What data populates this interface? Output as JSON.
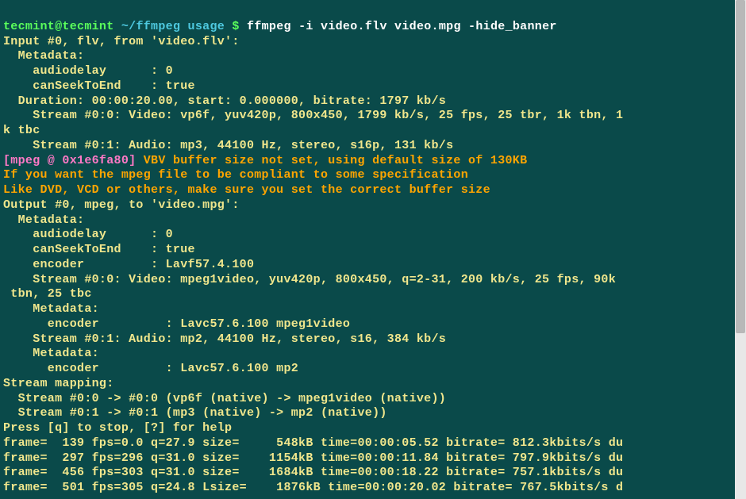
{
  "prompt": {
    "user": "tecmint@tecmint",
    "path": "~/ffmpeg usage",
    "symbol": "$",
    "command": "ffmpeg -i video.flv video.mpg -hide_banner"
  },
  "input_header": "Input #0, flv, from 'video.flv':",
  "metadata_label": "  Metadata:",
  "input_meta": {
    "audiodelay": "    audiodelay      : 0",
    "canSeekToEnd": "    canSeekToEnd    : true"
  },
  "duration": "  Duration: 00:00:20.00, start: 0.000000, bitrate: 1797 kb/s",
  "stream_v_in": "    Stream #0:0: Video: vp6f, yuv420p, 800x450, 1799 kb/s, 25 fps, 25 tbr, 1k tbn, 1",
  "stream_v_in_cont": "k tbc",
  "stream_a_in": "    Stream #0:1: Audio: mp3, 44100 Hz, stereo, s16p, 131 kb/s",
  "mpeg_tag": "[mpeg @ 0x1e6fa80]",
  "vbv_msg": " VBV buffer size not set, using default size of 130KB",
  "compliant1": "If you want the mpeg file to be compliant to some specification",
  "compliant2": "Like DVD, VCD or others, make sure you set the correct buffer size",
  "output_header": "Output #0, mpeg, to 'video.mpg':",
  "output_meta": {
    "audiodelay": "    audiodelay      : 0",
    "canSeekToEnd": "    canSeekToEnd    : true",
    "encoder": "    encoder         : Lavf57.4.100"
  },
  "stream_v_out": "    Stream #0:0: Video: mpeg1video, yuv420p, 800x450, q=2-31, 200 kb/s, 25 fps, 90k",
  "stream_v_out_cont": " tbn, 25 tbc",
  "sub_meta_label": "    Metadata:",
  "encoder_v": "      encoder         : Lavc57.6.100 mpeg1video",
  "stream_a_out": "    Stream #0:1: Audio: mp2, 44100 Hz, stereo, s16, 384 kb/s",
  "encoder_a": "      encoder         : Lavc57.6.100 mp2",
  "stream_mapping": "Stream mapping:",
  "map1": "  Stream #0:0 -> #0:0 (vp6f (native) -> mpeg1video (native))",
  "map2": "  Stream #0:1 -> #0:1 (mp3 (native) -> mp2 (native))",
  "press_q": "Press [q] to stop, [?] for help",
  "frames": [
    "frame=  139 fps=0.0 q=27.9 size=     548kB time=00:00:05.52 bitrate= 812.3kbits/s du",
    "frame=  297 fps=296 q=31.0 size=    1154kB time=00:00:11.84 bitrate= 797.9kbits/s du",
    "frame=  456 fps=303 q=31.0 size=    1684kB time=00:00:18.22 bitrate= 757.1kbits/s du",
    "frame=  501 fps=305 q=24.8 Lsize=    1876kB time=00:00:20.02 bitrate= 767.5kbits/s d"
  ]
}
